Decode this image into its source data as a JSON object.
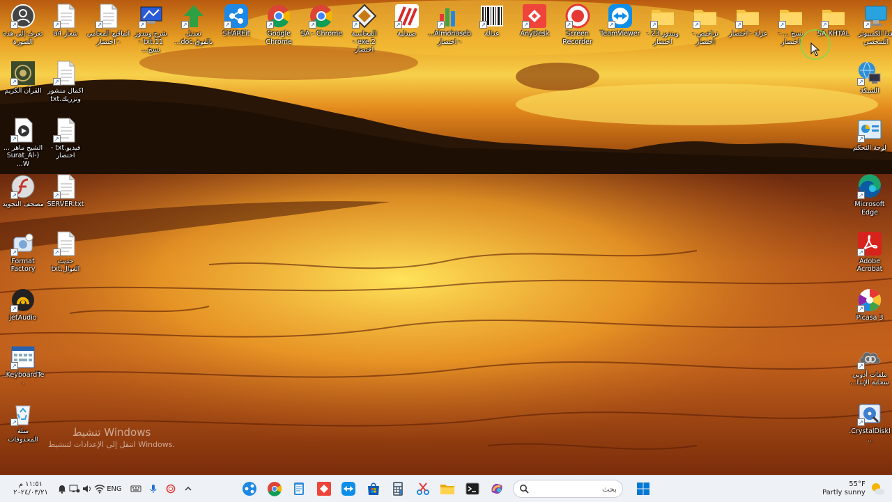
{
  "desktop": {
    "top_row": [
      {
        "label": "تعرف إلى هذه الصورة",
        "icon": "camera-icon",
        "color": "#444444"
      },
      {
        "label": "شعار a4",
        "icon": "image-file-icon",
        "color": "#ffffff"
      },
      {
        "label": "اتفاقيع المحامي - اختصار",
        "icon": "text-file-icon",
        "color": "#ffffff"
      },
      {
        "label": "شرح ويندوز 11.txt - نسخ...",
        "icon": "monitor-icon",
        "color": "#2a5bd7"
      },
      {
        "label": "تعديل بالفوق.doc...",
        "icon": "green-arrow-icon",
        "color": "#2ea043"
      },
      {
        "label": "SHAREit",
        "icon": "shareit-icon",
        "color": "#1e88e5"
      },
      {
        "label": "Google Chrome",
        "icon": "chrome-icon",
        "color": "#db4437"
      },
      {
        "label": "SA - Chrome",
        "icon": "chrome-profile-icon",
        "color": "#db4437"
      },
      {
        "label": "المحاسبة 2.exe - اختصار",
        "icon": "diamond-app-icon",
        "color": "#c77a12"
      },
      {
        "label": "صيدلية",
        "icon": "pharmacy-icon",
        "color": "#d62b2b"
      },
      {
        "label": "Almohaseb... - اختصار",
        "icon": "almohaseb-icon",
        "color": "#f4a21c"
      },
      {
        "label": "عدالة",
        "icon": "barcode-icon",
        "color": "#111111"
      },
      {
        "label": "AnyDesk",
        "icon": "anydesk-icon",
        "color": "#ef443b"
      },
      {
        "label": "Screen Recorder",
        "icon": "record-icon",
        "color": "#e53935"
      },
      {
        "label": "TeamViewer",
        "icon": "teamviewer-icon",
        "color": "#0e8ee9"
      },
      {
        "label": "ويندوز 23 - اختصار",
        "icon": "folder-icon",
        "color": "#f5c542"
      },
      {
        "label": "تراخيص - اختصار",
        "icon": "folder-icon",
        "color": "#f5c542"
      },
      {
        "label": "غزلة - اختصار",
        "icon": "folder-icon",
        "color": "#f5c542"
      },
      {
        "label": "نسخ ... - اختصار",
        "icon": "folder-icon",
        "color": "#f5c542"
      },
      {
        "label": "SA KHTAL",
        "icon": "folder-icon",
        "color": "#f5c542"
      },
      {
        "label": "هذا الكمبيوتر الشخصي",
        "icon": "computer-icon",
        "color": "#29a3e0"
      }
    ],
    "left_col1": [
      {
        "label": "القرآن الكريم",
        "icon": "quran-icon",
        "color": "#3a4a2a"
      },
      {
        "label": "الشيخ ماهر ... (Surat_Al-W...",
        "icon": "video-file-icon",
        "color": "#ffffff"
      },
      {
        "label": "مصحف التجويد",
        "icon": "flash-icon",
        "color": "#c0392b"
      },
      {
        "label": "Format Factory",
        "icon": "format-factory-icon",
        "color": "#7aa7d8"
      },
      {
        "label": "jetAudio",
        "icon": "jetaudio-icon",
        "color": "#222222"
      },
      {
        "label": "KeyboardTe...",
        "icon": "keyboard-app-icon",
        "color": "#2a62b0"
      },
      {
        "label": "سلة المحذوفات",
        "icon": "recycle-bin-icon",
        "color": "#3aa0e0"
      }
    ],
    "left_col2": [
      {
        "label": "اكمال منشور ونزريك.txt",
        "icon": "text-file-icon",
        "color": "#ffffff"
      },
      {
        "label": "فيديو.txt - اختصار",
        "icon": "text-file-icon",
        "color": "#ffffff"
      },
      {
        "label": "SERVER.txt",
        "icon": "text-file-icon",
        "color": "#ffffff"
      },
      {
        "label": "حديث الغوال.txt",
        "icon": "text-file-icon",
        "color": "#ffffff"
      }
    ],
    "right_col": [
      {
        "label": "الشبكة",
        "icon": "network-icon",
        "color": "#2d8fd6"
      },
      {
        "label": "لوحة التحكم",
        "icon": "control-panel-icon",
        "color": "#2d8fd6"
      },
      {
        "label": "Microsoft Edge",
        "icon": "edge-icon",
        "color": "#1aa36f"
      },
      {
        "label": "Adobe Acrobat",
        "icon": "acrobat-icon",
        "color": "#d6231c"
      },
      {
        "label": "Picasa 3",
        "icon": "picasa-icon",
        "color": "#e64a19"
      },
      {
        "label": "ملفات أدوبي سحابة الإبدا...",
        "icon": "creative-cloud-icon",
        "color": "#555555"
      },
      {
        "label": "CrystalDiskI...",
        "icon": "crystaldisk-icon",
        "color": "#3d7fd0"
      }
    ],
    "watermark": {
      "line1": "تنشيط Windows",
      "line2": "انتقل إلى الإعدادات لتنشيط Windows."
    }
  },
  "taskbar": {
    "clock_time": "١١:٥١ م",
    "clock_date": "٢٠٢٤/٠٣/٢١",
    "lang": "ENG",
    "search_placeholder": "بحث",
    "tray_icons": [
      "notification-icon",
      "network-tray-icon",
      "volume-icon",
      "wifi-icon"
    ],
    "tray_right_icons": [
      "keyboard-icon",
      "mic-icon",
      "record-tray-icon",
      "chevron-up-icon"
    ],
    "pinned": [
      "shareit-icon",
      "chrome-profile-icon",
      "notepad-icon",
      "anydesk-icon",
      "teamviewer-icon",
      "store-icon",
      "calculator-icon",
      "snipping-icon",
      "file-explorer-icon",
      "terminal-icon",
      "copilot-icon"
    ],
    "weather_temp": "55°F",
    "weather_desc": "Partly sunny",
    "accent": "#0078d4"
  }
}
